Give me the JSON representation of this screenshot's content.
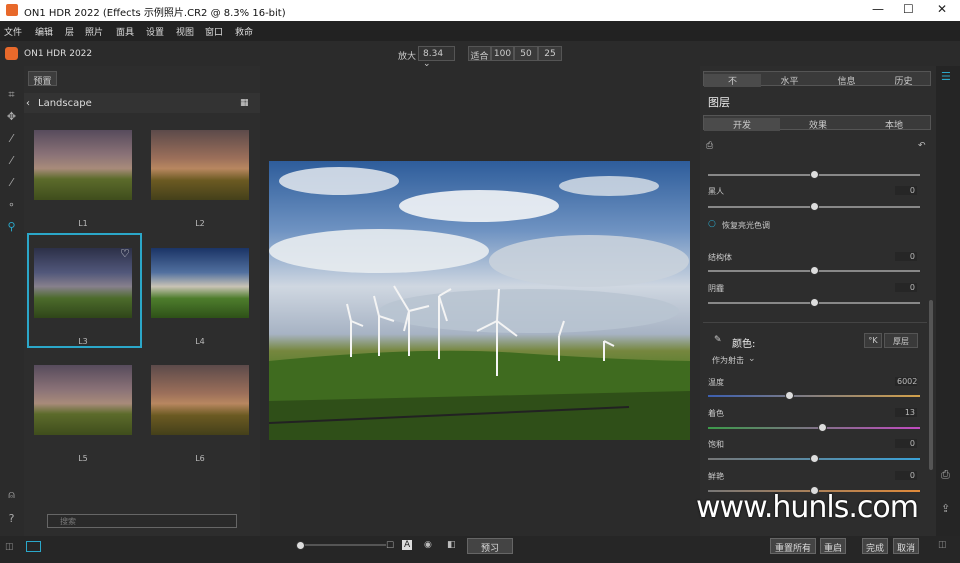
{
  "window": {
    "title": "ON1 HDR 2022 (Effects 示例照片.CR2 @ 8.3% 16-bit)",
    "min": "—",
    "max": "☐",
    "close": "✕"
  },
  "menu": [
    "文件",
    "编辑",
    "层",
    "照片",
    "面具",
    "设置",
    "视图",
    "窗口",
    "救命"
  ],
  "app": {
    "name": "ON1 HDR 2022"
  },
  "zoom": {
    "label": "放大",
    "value": "8.34",
    "fit": "适合",
    "z100": "100",
    "z50": "50",
    "z25": "25"
  },
  "browser": {
    "preset_tab": "预置",
    "category": "Landscape",
    "search_placeholder": "搜索",
    "thumbs": [
      {
        "label": "L1"
      },
      {
        "label": "L2"
      },
      {
        "label": "L3"
      },
      {
        "label": "L4"
      },
      {
        "label": "L5"
      },
      {
        "label": "L6"
      }
    ]
  },
  "right": {
    "tabs": [
      "不",
      "水平",
      "信息",
      "历史"
    ],
    "section": "图层",
    "subtabs": [
      "开发",
      "效果",
      "本地"
    ],
    "sliders": [
      {
        "label": "黑人",
        "value": "0",
        "level": 0.5
      },
      {
        "label": "结构体",
        "value": "0",
        "level": 0.5
      },
      {
        "label": "阴霾",
        "value": "0",
        "level": 0.5
      }
    ],
    "restore": "恢复亮光色调",
    "color": {
      "title": "颜色:",
      "k_btn": "°K",
      "preset_btn": "厚层",
      "mode": "作为射击",
      "items": [
        {
          "label": "温度",
          "value": "6002",
          "level": 0.38
        },
        {
          "label": "着色",
          "value": "13",
          "level": 0.54
        },
        {
          "label": "饱和",
          "value": "0",
          "level": 0.5
        },
        {
          "label": "鲜艳",
          "value": "0",
          "level": 0.5
        }
      ]
    }
  },
  "bottom": {
    "preview": "预习",
    "reset_all": "重置所有",
    "reset": "重启",
    "done": "完成",
    "cancel": "取消"
  },
  "watermark": "www.hunls.com"
}
